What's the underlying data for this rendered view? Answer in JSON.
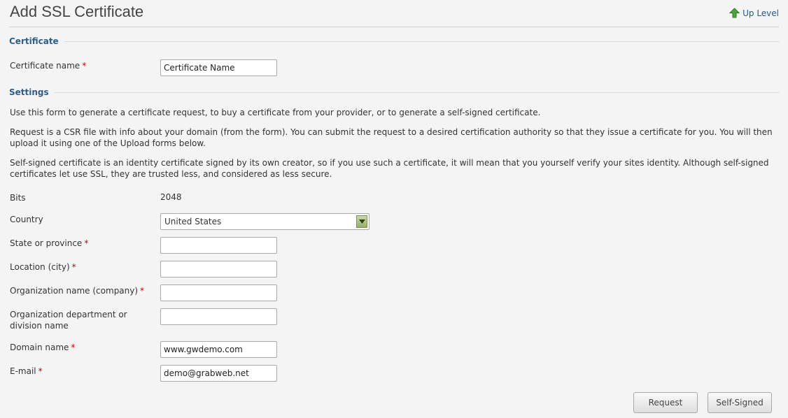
{
  "header": {
    "title": "Add SSL Certificate",
    "up_level": "Up Level"
  },
  "sections": {
    "certificate": "Certificate",
    "settings": "Settings"
  },
  "certificate_name": {
    "label": "Certificate name",
    "required": "*",
    "value": "Certificate Name"
  },
  "paragraphs": [
    "Use this form to generate a certificate request, to buy a certificate from your provider, or to generate a self-signed certificate.",
    "Request is a CSR file with info about your domain (from the form). You can submit the request to a desired certification authority so that they issue a certificate for you. You will then upload it using one of the Upload forms below.",
    "Self-signed certificate is an identity certificate signed by its own creator, so if you use such a certificate, it will mean that you yourself verify your sites identity. Although self-signed certificates let use SSL, they are trusted less, and considered as less secure."
  ],
  "fields": {
    "bits": {
      "label": "Bits",
      "value": "2048"
    },
    "country": {
      "label": "Country",
      "value": "United States"
    },
    "state": {
      "label": "State or province",
      "required": "*",
      "value": ""
    },
    "location": {
      "label": "Location (city)",
      "required": "*",
      "value": ""
    },
    "organization": {
      "label": "Organization name (company)",
      "required": "*",
      "value": ""
    },
    "department": {
      "label": "Organization department or division name",
      "value": ""
    },
    "domain": {
      "label": "Domain name",
      "required": "*",
      "value": "www.gwdemo.com"
    },
    "email": {
      "label": "E-mail",
      "required": "*",
      "value": "demo@grabweb.net"
    }
  },
  "buttons": {
    "request": "Request",
    "self_signed": "Self-Signed"
  },
  "colors": {
    "accent": "#2e5e86",
    "required": "#cc0000",
    "link": "#1e5a8a",
    "up_icon": "#3c9a2a"
  },
  "icons": {
    "up_level": "up-arrow-icon",
    "select_arrow": "chevron-down-icon"
  }
}
